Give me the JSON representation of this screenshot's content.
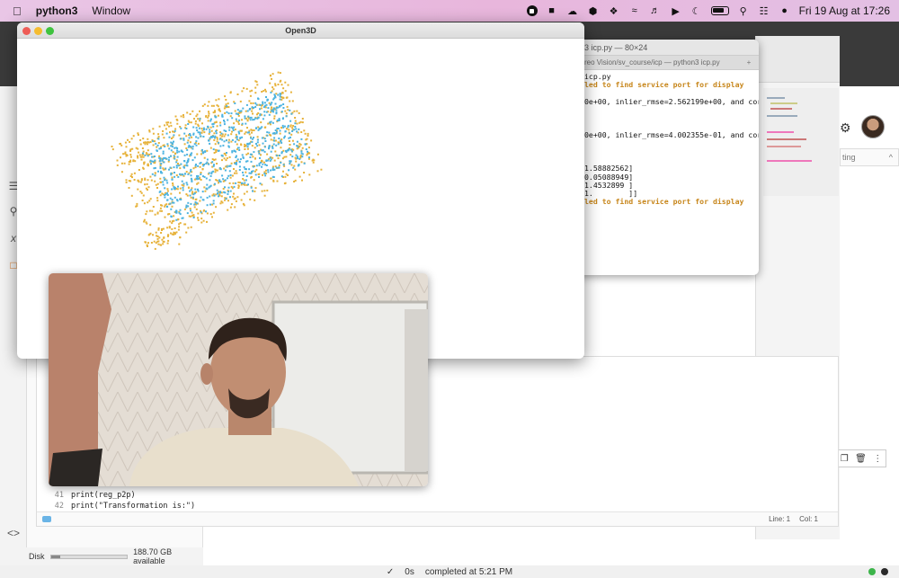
{
  "menubar": {
    "app_name": "python3",
    "menu_window": "Window",
    "datetime": "Fri 19 Aug at 17:26"
  },
  "open3d": {
    "title": "Open3D",
    "colors": {
      "source_points": "#e7b23a",
      "target_points": "#4cb3e0"
    }
  },
  "terminal": {
    "title": "3 icp.py — 80×24",
    "tab_label": "reo Vision/sv_course/icp — python3 icp.py",
    "lines": [
      {
        "text": "icp.py",
        "warn": false
      },
      {
        "text": "led to find service port for display",
        "warn": true
      },
      {
        "text": "",
        "warn": false
      },
      {
        "text": "0e+00, inlier_rmse=2.562199e+00, and corr",
        "warn": false
      },
      {
        "text": "",
        "warn": false
      },
      {
        "text": "",
        "warn": false
      },
      {
        "text": "",
        "warn": false
      },
      {
        "text": "0e+00, inlier_rmse=4.002355e-01, and corr",
        "warn": false
      },
      {
        "text": "",
        "warn": false
      },
      {
        "text": "",
        "warn": false
      },
      {
        "text": "",
        "warn": false
      },
      {
        "text": "1.58882562]",
        "warn": false
      },
      {
        "text": "0.05088949]",
        "warn": false
      },
      {
        "text": "1.4532899 ]",
        "warn": false
      },
      {
        "text": "1.        ]]",
        "warn": false
      },
      {
        "text": "led to find service port for display",
        "warn": true
      }
    ]
  },
  "editor": {
    "code": [
      {
        "num": "41",
        "code": "print(reg_p2p)"
      },
      {
        "num": "42",
        "code": "print(\"Transformation is:\")"
      }
    ],
    "status_line": "Line: 1",
    "status_col": "Col: 1"
  },
  "right_panel": {
    "tab_text": "ting"
  },
  "disk": {
    "label": "Disk",
    "available": "188.70 GB available",
    "used_fraction": 0.12
  },
  "statusbar": {
    "duration": "0s",
    "completed": "completed at 5:21 PM"
  }
}
